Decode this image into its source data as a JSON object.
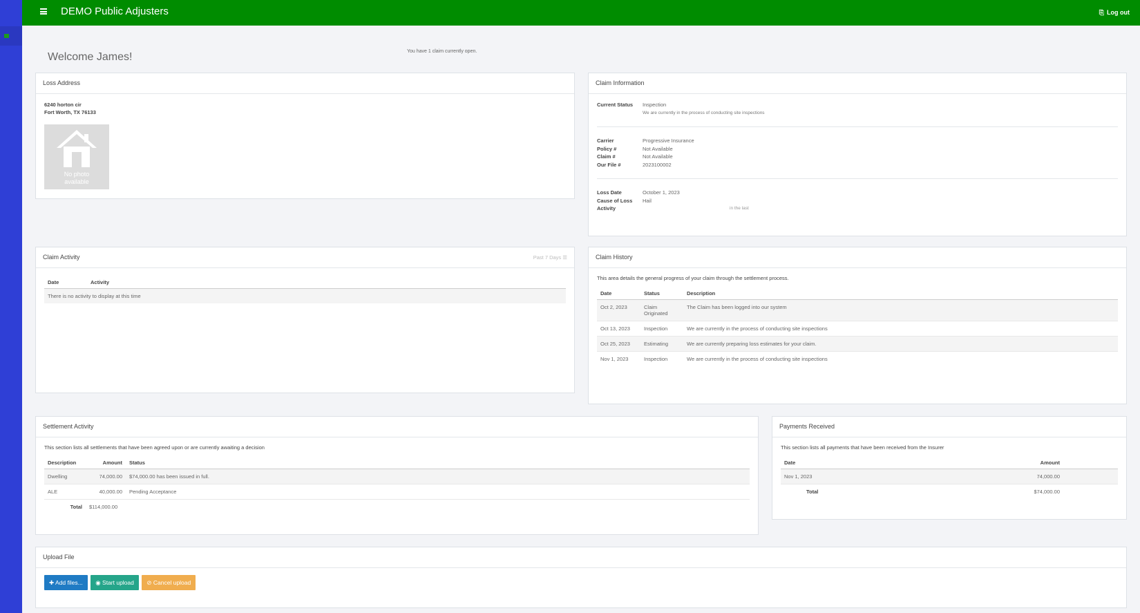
{
  "header": {
    "title": "DEMO Public Adjusters",
    "logout_label": "Log out",
    "color": "#008c00"
  },
  "sidebar": {
    "color": "#2f3fd6"
  },
  "welcome": {
    "greeting": "Welcome James!",
    "open_claims_note": "You have 1 claim currently open."
  },
  "loss_address": {
    "title": "Loss Address",
    "line1": "6240 horton cir",
    "line2": "Fort Worth, TX 76133",
    "photo_text_1": "No photo",
    "photo_text_2": "available"
  },
  "claim_info": {
    "title": "Claim Information",
    "current_status_label": "Current Status",
    "current_status_value": "Inspection",
    "current_status_note": "We are currently in the process of conducting site inspections",
    "carrier_label": "Carrier",
    "carrier_value": "Progressive Insurance",
    "policy_label": "Policy #",
    "policy_value": "Not Available",
    "claim_label": "Claim #",
    "claim_value": "Not Available",
    "file_label": "Our File #",
    "file_value": "2023100002",
    "loss_date_label": "Loss Date",
    "loss_date_value": "October 1, 2023",
    "cause_label": "Cause of Loss",
    "cause_value": "Hail",
    "activity_label": "Activity",
    "activity_value": "in the last"
  },
  "claim_activity": {
    "title": "Claim Activity",
    "filter_label": "Past 7 Days",
    "columns": [
      "Date",
      "Activity"
    ],
    "empty_message": "There is no activity to display at this time"
  },
  "claim_history": {
    "title": "Claim History",
    "description": "This area details the general progress of your claim through the settlement process.",
    "columns": [
      "Date",
      "Status",
      "Description"
    ],
    "rows": [
      {
        "date": "Oct 2, 2023",
        "status": "Claim Originated",
        "description": "The Claim has been logged into our system"
      },
      {
        "date": "Oct 13, 2023",
        "status": "Inspection",
        "description": "We are currently in the process of conducting site inspections"
      },
      {
        "date": "Oct 25, 2023",
        "status": "Estimating",
        "description": "We are currently preparing loss estimates for your claim."
      },
      {
        "date": "Nov 1, 2023",
        "status": "Inspection",
        "description": "We are currently in the process of conducting site inspections"
      }
    ]
  },
  "settlement": {
    "title": "Settlement Activity",
    "description": "This section lists all settlements that have been agreed upon or are currently awaiting a decision",
    "columns": [
      "Description",
      "Amount",
      "Status"
    ],
    "rows": [
      {
        "description": "Dwelling",
        "amount": "74,000.00",
        "status": "$74,000.00 has been issued in full."
      },
      {
        "description": "ALE",
        "amount": "40,000.00",
        "status": "Pending Acceptance"
      }
    ],
    "total_label": "Total",
    "total_value": "$114,000.00"
  },
  "payments": {
    "title": "Payments Received",
    "description": "This section lists all payments that have been received from the Insurer",
    "columns": [
      "Date",
      "Amount"
    ],
    "rows": [
      {
        "date": "Nov 1, 2023",
        "amount": "74,000.00"
      }
    ],
    "total_label": "Total",
    "total_value": "$74,000.00"
  },
  "upload": {
    "title": "Upload File",
    "add_label": "Add files...",
    "start_label": "Start upload",
    "cancel_label": "Cancel upload"
  }
}
